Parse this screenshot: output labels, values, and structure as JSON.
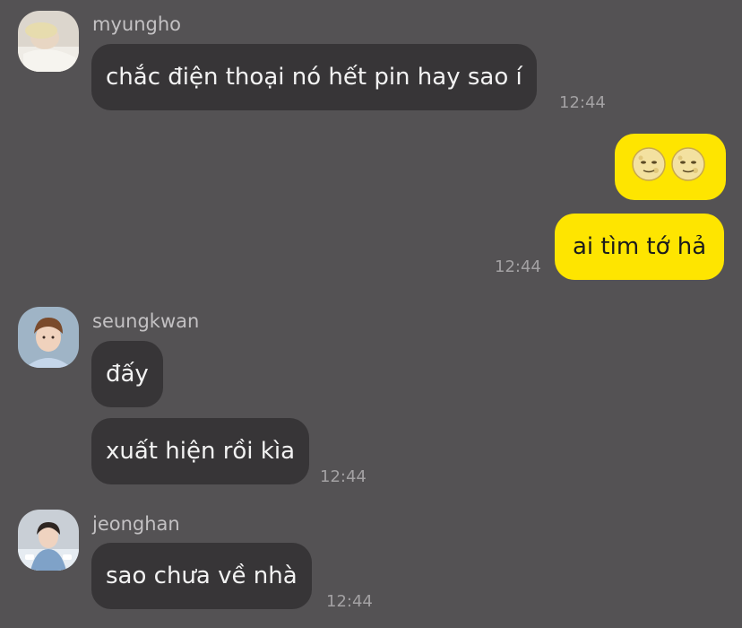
{
  "colors": {
    "background": "#545254",
    "incoming_bubble": "#373537",
    "outgoing_bubble": "#fee500",
    "sender_name": "#c3c1c3",
    "timestamp": "#a3a1a3"
  },
  "messages": [
    {
      "sender": "myungho",
      "text": "chắc điện thoại nó hết pin hay sao í",
      "time": "12:44"
    },
    {
      "direction": "outgoing",
      "emoji": [
        "full-moon-face-icon",
        "full-moon-face-icon"
      ]
    },
    {
      "direction": "outgoing",
      "text": "ai tìm tớ hả",
      "time": "12:44"
    },
    {
      "sender": "seungkwan",
      "text": "đấy"
    },
    {
      "text": "xuất hiện rồi kìa",
      "time": "12:44"
    },
    {
      "sender": "jeonghan",
      "text": "sao chưa về nhà",
      "time": "12:44"
    }
  ]
}
